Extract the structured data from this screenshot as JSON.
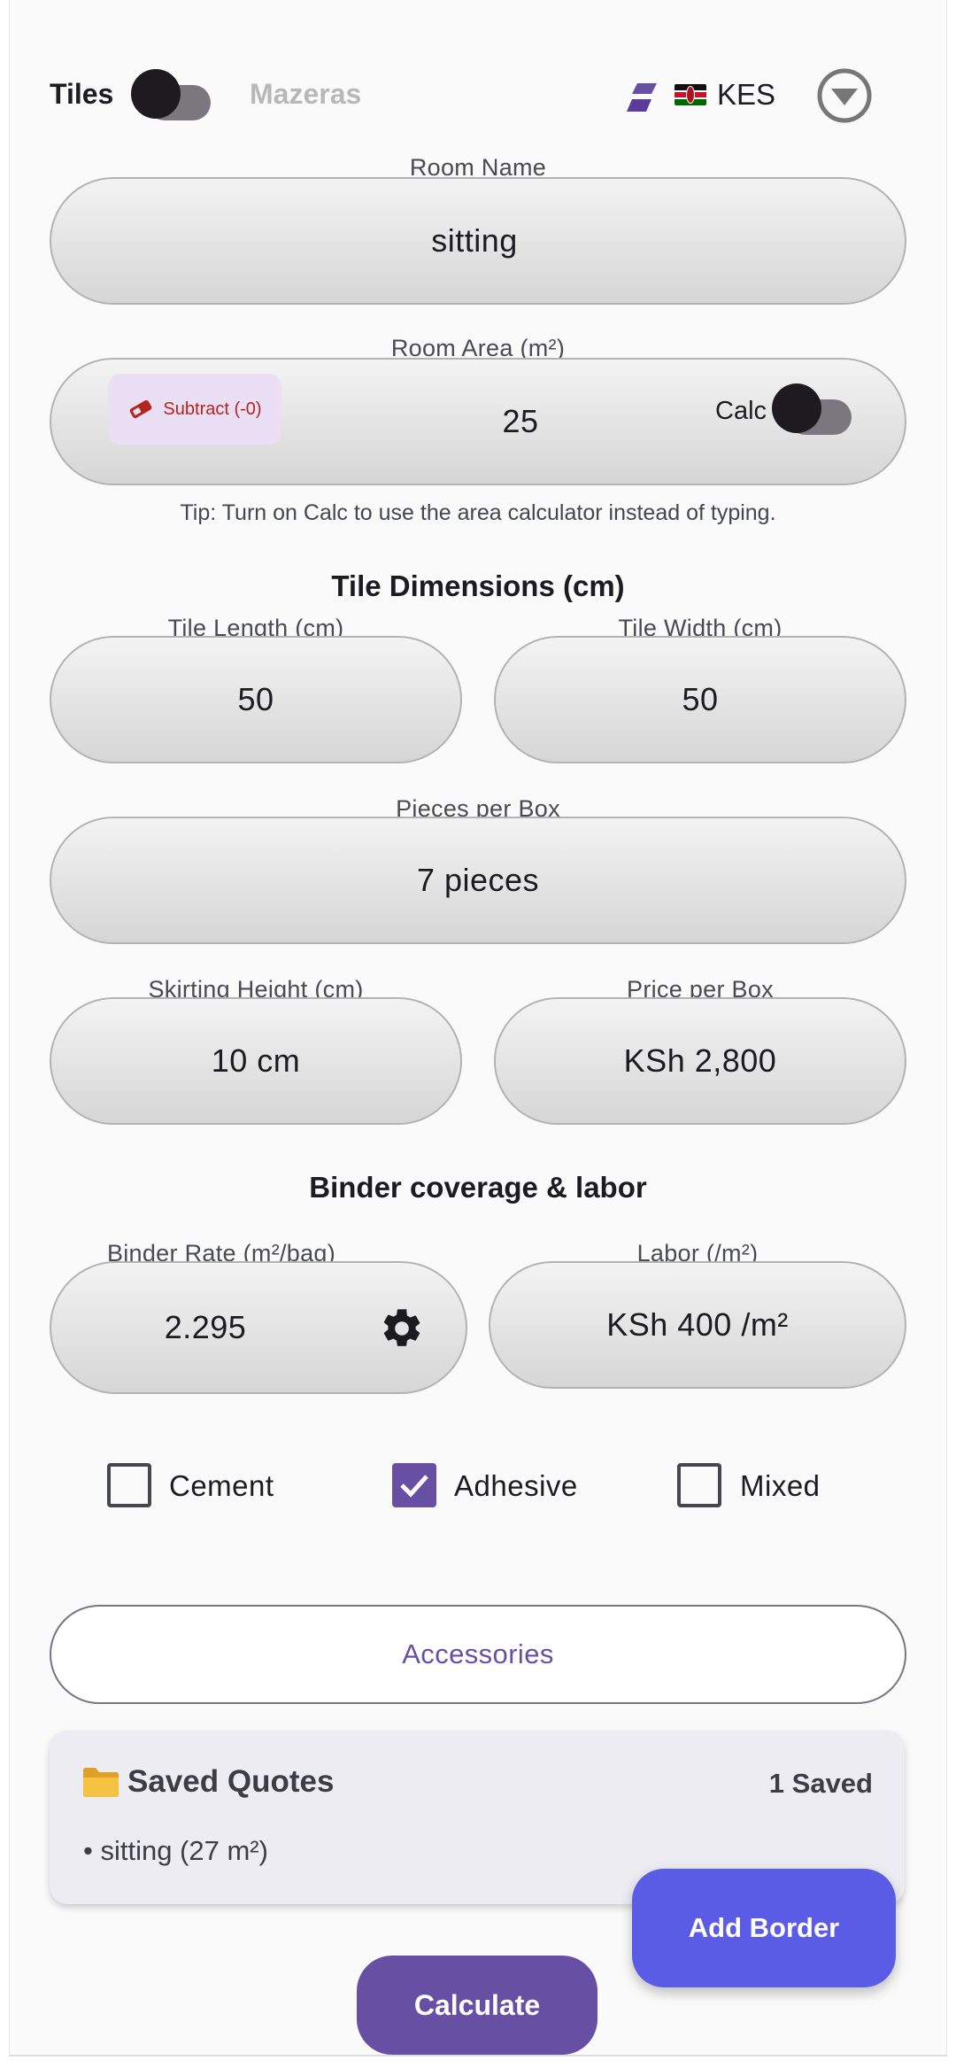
{
  "header": {
    "mode_left": "Tiles",
    "mode_right": "Mazeras",
    "mode_toggle_on": false,
    "currency": "KES",
    "currency_flag": "kenya-flag-icon"
  },
  "room_name": {
    "label": "Room Name",
    "value": "sitting"
  },
  "room_area": {
    "label": "Room Area (m²)",
    "value": "25",
    "subtract_label": "Subtract (-0)",
    "calc_label": "Calc",
    "calc_on": false
  },
  "tip": "Tip: Turn on Calc to use the area calculator instead of typing.",
  "tile_dimensions": {
    "title": "Tile Dimensions (cm)",
    "length_label": "Tile Length (cm)",
    "length_value": "50",
    "width_label": "Tile Width (cm)",
    "width_value": "50"
  },
  "pieces_per_box": {
    "label": "Pieces per Box",
    "value": "7 pieces"
  },
  "skirting": {
    "label": "Skirting Height (cm)",
    "value": "10 cm"
  },
  "price_per_box": {
    "label": "Price per Box",
    "value": "KSh 2,800"
  },
  "binder": {
    "title": "Binder coverage & labor",
    "rate_label": "Binder Rate (m²/bag)",
    "rate_value": "2.295",
    "labor_label": "Labor (/m²)",
    "labor_value": "KSh 400 /m²"
  },
  "binder_types": [
    {
      "label": "Cement",
      "checked": false
    },
    {
      "label": "Adhesive",
      "checked": true
    },
    {
      "label": "Mixed",
      "checked": false
    }
  ],
  "accessories_label": "Accessories",
  "saved_quotes": {
    "title": "Saved Quotes",
    "count": "1 Saved",
    "items": [
      "• sitting (27 m²)"
    ]
  },
  "add_border_label": "Add Border",
  "calculate_label": "Calculate",
  "colors": {
    "primary": "#6750a4",
    "add_border": "#5b5ce6",
    "field_border": "#b3b3b3",
    "subtract_chip": "#ebdff5",
    "subtract_text": "#b3261e"
  }
}
